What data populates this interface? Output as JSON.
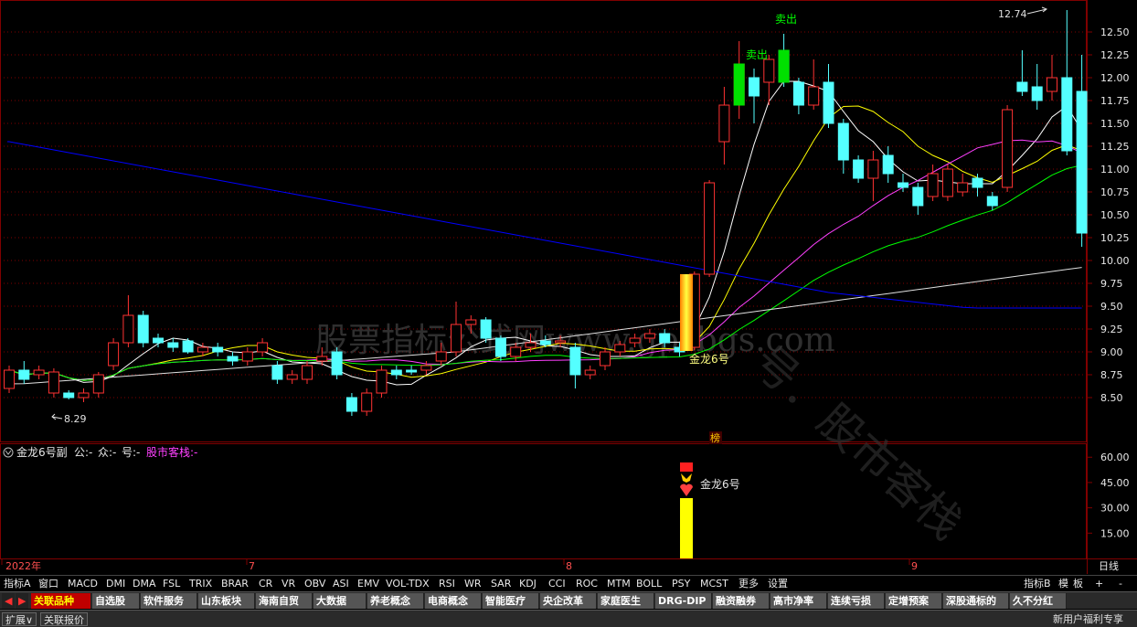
{
  "price_axis": {
    "ticks": [
      "12.50",
      "12.25",
      "12.00",
      "11.75",
      "11.50",
      "11.25",
      "11.00",
      "10.75",
      "10.50",
      "10.25",
      "10.00",
      "9.75",
      "9.50",
      "9.25",
      "9.00",
      "8.75",
      "8.50"
    ],
    "high_label": "12.74",
    "low_label": "8.29"
  },
  "indicator_axis": {
    "ticks": [
      "60.00",
      "45.00",
      "30.00",
      "15.00"
    ]
  },
  "sub_header": {
    "title": "金龙6号副",
    "f1": "公:-",
    "f2": "众:-",
    "f3": "号:-",
    "brand": "股市客栈:-"
  },
  "time_axis": {
    "labels": [
      "2022年",
      "7",
      "8",
      "9"
    ],
    "period": "日线"
  },
  "annotations": {
    "sell1": "卖出",
    "sell2": "卖出",
    "signal_main": "金龙6号",
    "signal_sub": "金龙6号",
    "bang": "榜"
  },
  "watermarks": {
    "w1": "股票指标公式网www.gpzbgs.com",
    "w2": "号．股市客栈"
  },
  "indicator_tabs": [
    "指标A",
    "窗口",
    "MACD",
    "DMI",
    "DMA",
    "FSL",
    "TRIX",
    "BRAR",
    "CR",
    "VR",
    "OBV",
    "ASI",
    "EMV",
    "VOL-TDX",
    "RSI",
    "WR",
    "SAR",
    "KDJ",
    "CCI",
    "ROC",
    "MTM",
    "BOLL",
    "PSY",
    "MCST",
    "更多",
    "设置"
  ],
  "indicator_right": [
    "指标B",
    "模",
    "板",
    "+",
    "-"
  ],
  "sector_tabs": [
    "关联品种",
    "自选股",
    "软件服务",
    "山东板块",
    "海南自贸",
    "大数据",
    "养老概念",
    "电商概念",
    "智能医疗",
    "央企改革",
    "家庭医生",
    "DRG-DIP",
    "融资融券",
    "高市净率",
    "连续亏损",
    "定增预案",
    "深股通标的",
    "久不分红"
  ],
  "status": {
    "expand": "扩展∨",
    "related": "关联报价",
    "right": "新用户福利专享"
  },
  "colors": {
    "up": "#ff3232",
    "down": "#54ffff",
    "ma_white": "#ffffff",
    "ma_yellow": "#ffff00",
    "ma_magenta": "#ff40ff",
    "ma_green": "#00ff00",
    "ma_blue": "#0000ff",
    "grid": "#800000"
  },
  "chart_data": {
    "type": "candlestick",
    "candles": [
      [
        8.6,
        8.8,
        8.85,
        8.55
      ],
      [
        8.8,
        8.7,
        8.9,
        8.65
      ],
      [
        8.75,
        8.8,
        8.85,
        8.7
      ],
      [
        8.55,
        8.78,
        8.82,
        8.5
      ],
      [
        8.55,
        8.5,
        8.58,
        8.48
      ],
      [
        8.5,
        8.55,
        8.6,
        8.45
      ],
      [
        8.55,
        8.75,
        8.78,
        8.5
      ],
      [
        8.85,
        9.1,
        9.15,
        8.8
      ],
      [
        9.1,
        9.4,
        9.62,
        9.05
      ],
      [
        9.4,
        9.1,
        9.45,
        9.05
      ],
      [
        9.15,
        9.1,
        9.2,
        9.05
      ],
      [
        9.1,
        9.05,
        9.15,
        9.0
      ],
      [
        9.12,
        9.0,
        9.15,
        8.98
      ],
      [
        9.0,
        9.05,
        9.1,
        8.95
      ],
      [
        9.05,
        9.0,
        9.1,
        8.95
      ],
      [
        8.95,
        8.9,
        9.0,
        8.85
      ],
      [
        8.9,
        9.0,
        9.05,
        8.85
      ],
      [
        9.0,
        9.1,
        9.15,
        8.95
      ],
      [
        8.85,
        8.7,
        8.9,
        8.65
      ],
      [
        8.7,
        8.75,
        8.8,
        8.65
      ],
      [
        8.7,
        8.85,
        8.9,
        8.65
      ],
      [
        8.9,
        8.95,
        9.05,
        8.85
      ],
      [
        9.0,
        8.75,
        9.05,
        8.7
      ],
      [
        8.5,
        8.35,
        8.55,
        8.3
      ],
      [
        8.35,
        8.55,
        8.6,
        8.3
      ],
      [
        8.55,
        8.8,
        8.85,
        8.5
      ],
      [
        8.8,
        8.75,
        8.85,
        8.7
      ],
      [
        8.8,
        8.78,
        8.85,
        8.75
      ],
      [
        8.8,
        8.85,
        8.9,
        8.75
      ],
      [
        8.9,
        9.0,
        9.1,
        8.85
      ],
      [
        9.0,
        9.3,
        9.55,
        8.95
      ],
      [
        9.3,
        9.35,
        9.4,
        9.2
      ],
      [
        9.35,
        9.15,
        9.38,
        9.1
      ],
      [
        9.15,
        8.95,
        9.18,
        8.9
      ],
      [
        8.95,
        9.05,
        9.1,
        8.9
      ],
      [
        9.05,
        9.1,
        9.2,
        9.0
      ],
      [
        9.12,
        9.08,
        9.18,
        9.05
      ],
      [
        9.1,
        9.12,
        9.18,
        9.05
      ],
      [
        9.05,
        8.75,
        9.1,
        8.6
      ],
      [
        8.75,
        8.8,
        8.85,
        8.7
      ],
      [
        8.85,
        9.0,
        9.05,
        8.8
      ],
      [
        9.0,
        9.08,
        9.12,
        8.95
      ],
      [
        9.1,
        9.15,
        9.2,
        9.05
      ],
      [
        9.15,
        9.2,
        9.25,
        9.1
      ],
      [
        9.2,
        9.1,
        9.25,
        9.05
      ],
      [
        9.05,
        9.0,
        9.1,
        8.95
      ],
      [
        9.05,
        9.85,
        9.88,
        9.02
      ],
      [
        9.85,
        10.85,
        10.88,
        9.82
      ],
      [
        11.3,
        11.7,
        11.9,
        11.05
      ],
      [
        11.7,
        12.15,
        12.4,
        11.55
      ],
      [
        12.0,
        11.8,
        12.1,
        11.5
      ],
      [
        11.95,
        12.2,
        12.25,
        11.7
      ],
      [
        12.3,
        11.95,
        12.48,
        11.9
      ],
      [
        11.95,
        11.7,
        12.0,
        11.6
      ],
      [
        11.7,
        11.9,
        12.2,
        11.65
      ],
      [
        11.95,
        11.5,
        12.15,
        11.45
      ],
      [
        11.5,
        11.1,
        11.55,
        10.95
      ],
      [
        11.1,
        10.9,
        11.15,
        10.85
      ],
      [
        10.9,
        11.1,
        11.2,
        10.65
      ],
      [
        11.15,
        10.95,
        11.25,
        10.85
      ],
      [
        10.85,
        10.8,
        10.95,
        10.75
      ],
      [
        10.8,
        10.6,
        10.85,
        10.5
      ],
      [
        10.7,
        10.95,
        11.05,
        10.65
      ],
      [
        10.7,
        11.0,
        11.05,
        10.65
      ],
      [
        10.75,
        10.85,
        10.95,
        10.7
      ],
      [
        10.9,
        10.8,
        10.95,
        10.7
      ],
      [
        10.7,
        10.6,
        10.75,
        10.55
      ],
      [
        10.8,
        11.65,
        11.7,
        10.75
      ],
      [
        11.95,
        11.85,
        12.3,
        11.8
      ],
      [
        11.9,
        11.75,
        12.15,
        11.65
      ],
      [
        11.85,
        12.0,
        12.25,
        11.75
      ],
      [
        12.0,
        11.2,
        12.74,
        11.15
      ],
      [
        11.85,
        10.3,
        12.25,
        10.15
      ]
    ],
    "series": [
      {
        "name": "MA-white"
      },
      {
        "name": "MA-yellow"
      },
      {
        "name": "MA-magenta"
      },
      {
        "name": "MA-green"
      },
      {
        "name": "MA-blue"
      }
    ],
    "ylim": [
      8.35,
      12.75
    ],
    "sub_ylim": [
      0,
      65
    ],
    "sub_bar": {
      "value": 45
    }
  }
}
